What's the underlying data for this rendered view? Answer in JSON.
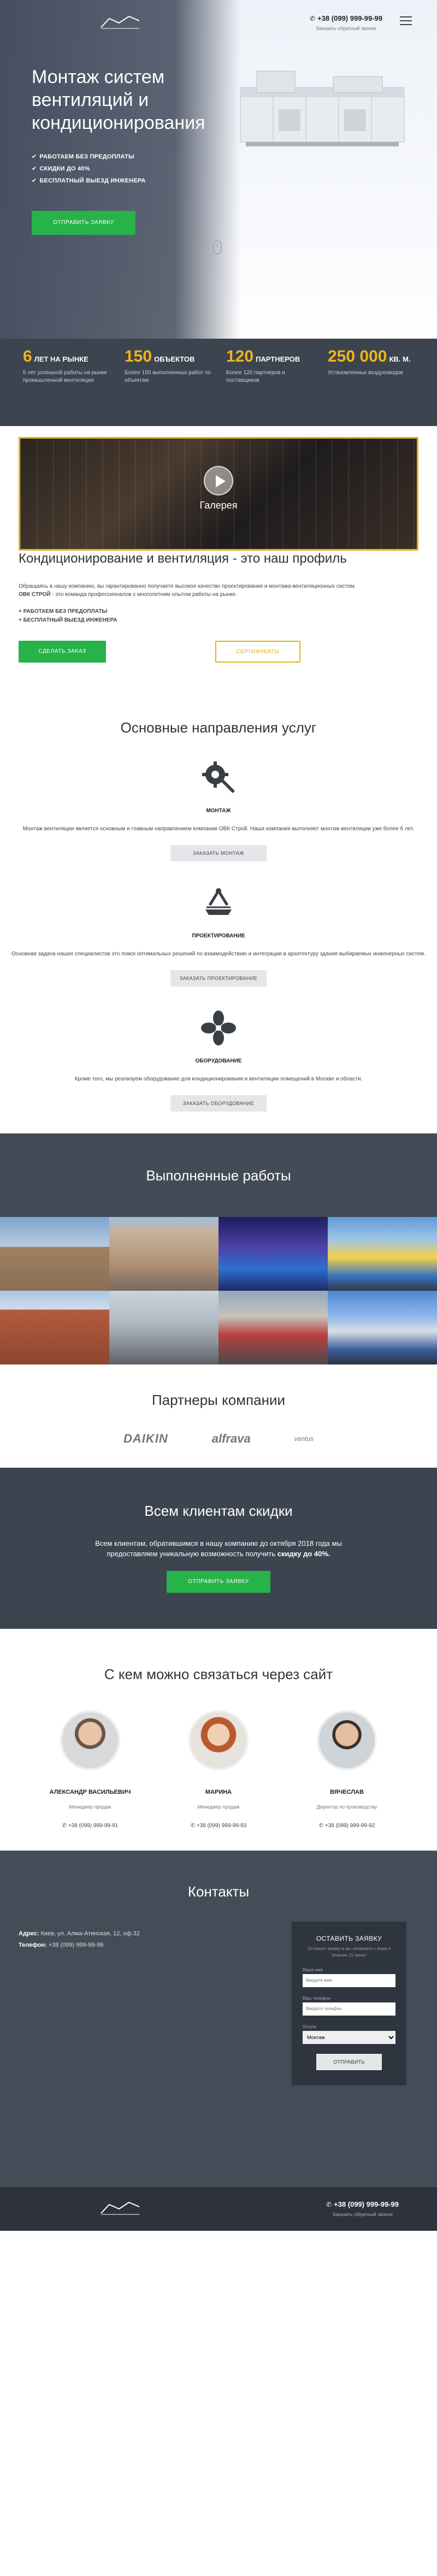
{
  "header": {
    "phone": "+38 (099) 999-99-99",
    "callback": "Заказать обратный звонок",
    "phone_icon": "phone-icon",
    "menu_icon": "hamburger-menu-icon"
  },
  "hero": {
    "title": "Монтаж систем вентиляций и кондиционирования",
    "features": [
      "РАБОТАЕМ БЕЗ ПРЕДОПЛАТЫ",
      "СКИДКИ ДО 40%",
      "БЕСПЛАТНЫЙ ВЫЕЗД ИНЖЕНЕРА"
    ],
    "cta": "ОТПРАВИТЬ ЗАЯВКУ"
  },
  "stats": [
    {
      "num": "6",
      "unit": "ЛЕТ НА РЫНКЕ",
      "desc": "6 лет успешной работы на рынке промышленной вентиляции"
    },
    {
      "num": "150",
      "unit": "ОБЪЕКТОВ",
      "desc": "Более 150 выполненных работ по объектам"
    },
    {
      "num": "120",
      "unit": "ПАРТНЕРОВ",
      "desc": "Более 120 партнеров и поставщиков"
    },
    {
      "num": "250 000",
      "unit": "КВ. М.",
      "desc": "Установленных воздуховодов"
    }
  ],
  "gallery": {
    "video_label": "Галерея",
    "title": "Кондиционирование и вентиляция - это наш профиль",
    "intro_a": "Обращаясь в нашу компанию, вы гарантированно получаете высокое качество проектирования и монтажа вентиляционных систем.",
    "intro_brand": "ОВК СТРОЙ",
    "intro_b": " - это команда профессионалов с многолетним опытом работы на рынке.",
    "list": [
      "+ РАБОТАЕМ БЕЗ ПРЕДОПЛАТЫ",
      "+ БЕСПЛАТНЫЙ ВЫЕЗД ИНЖЕНЕРА"
    ],
    "btn_primary": "СДЕЛАТЬ ЗАКАЗ",
    "btn_secondary": "СЕРТИФИКАТЫ"
  },
  "services": {
    "title": "Основные направления услуг",
    "items": [
      {
        "icon": "wrench-gear-icon",
        "name": "МОНТАЖ",
        "text": "Монтаж вентиляции является основным и главным направлением компании ОВК Строй. Наша компания выполняет монтаж вентиляции уже более 6 лет.",
        "btn": "ЗАКАЗАТЬ МОНТАЖ"
      },
      {
        "icon": "drafting-icon",
        "name": "ПРОЕКТИРОВАНИЕ",
        "text": "Основная задача наших специалистов это поиск оптимальных решений по взаимодействию и интеграции в архитектуру здания выбираемых инженерных систем.",
        "btn": "ЗАКАЗАТЬ ПРОЕКТИРОВАНИЕ"
      },
      {
        "icon": "fan-icon",
        "name": "ОБОРУДОВАНИЕ",
        "text": "Кроме того, мы реализуем оборудование для кондиционирования и вентиляции помещений в Москве и области.",
        "btn": "ЗАКАЗАТЬ ОБОРУДОВАНИЕ"
      }
    ]
  },
  "works": {
    "title": "Выполненные работы",
    "photos": [
      "classic-building-photo",
      "highrise-tower-photo",
      "pool-interior-photo",
      "mall-facade-photo",
      "brick-building-photo",
      "warehouse-exterior-photo",
      "shopping-street-photo",
      "office-center-photo"
    ]
  },
  "partners": {
    "title": "Партнеры компании",
    "logos": [
      "DAIKIN",
      "alfrava",
      "ventus"
    ]
  },
  "discount": {
    "title": "Всем клиентам скидки",
    "text_a": "Всем клиентам, обратившимся в нашу компанию до октября 2018 года мы предоставляем уникальную возможность получить ",
    "text_b": "скидку до 40%.",
    "cta": "ОТПРАВИТЬ ЗАЯВКУ"
  },
  "people": {
    "title": "С кем можно связаться через сайт",
    "items": [
      {
        "name": "АЛЕКСАНДР ВАСИЛЬЕВИЧ",
        "role": "Менеджер продаж",
        "phone": "+38 (099) 999-99-91"
      },
      {
        "name": "МАРИНА",
        "role": "Менеджер продаж",
        "phone": "+38 (099) 999-99-93"
      },
      {
        "name": "ВЯЧЕСЛАВ",
        "role": "Директор по производству",
        "phone": "+38 (099) 999-99-92"
      }
    ]
  },
  "contacts": {
    "title": "Контакты",
    "addr_label": "Адрес:",
    "addr": "Киев, ул. Алма-Атинская, 12, оф.32",
    "tel_label": "Телефон:",
    "tel": "+38 (099) 999-99-99",
    "form": {
      "title": "ОСТАВИТЬ ЗАЯВКУ",
      "sub": "Оставьте заявку и мы свяжемся с вами в течении 15 минут",
      "name_label": "Ваше имя",
      "name_ph": "Введите имя",
      "phone_label": "Ваш телефон",
      "phone_ph": "Введите телефон",
      "service_label": "Услуга",
      "service_value": "Монтаж",
      "submit": "ОТПРАВИТЬ"
    }
  },
  "colors": {
    "accent_yellow": "#e4b116",
    "green": "#27b34a",
    "dark": "#3c4450"
  }
}
